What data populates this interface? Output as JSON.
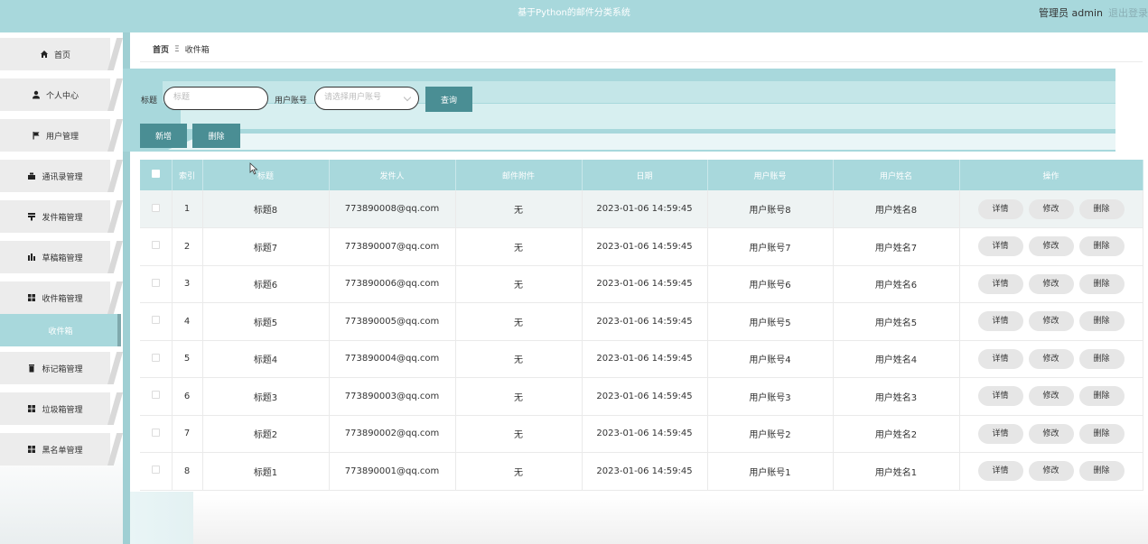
{
  "header": {
    "title": "基于Python的邮件分类系统",
    "user": "管理员 admin",
    "logout": "退出登录"
  },
  "sidebar": {
    "items": [
      {
        "label": "首页",
        "icon": "home-icon"
      },
      {
        "label": "个人中心",
        "icon": "user-icon"
      },
      {
        "label": "用户管理",
        "icon": "flag-icon"
      },
      {
        "label": "通讯录管理",
        "icon": "contacts-icon"
      },
      {
        "label": "发件箱管理",
        "icon": "outbox-icon"
      },
      {
        "label": "草稿箱管理",
        "icon": "drafts-icon"
      },
      {
        "label": "收件箱管理",
        "icon": "grid-icon"
      },
      {
        "label": "标记箱管理",
        "icon": "trash-can-icon"
      },
      {
        "label": "垃圾箱管理",
        "icon": "grid-icon"
      },
      {
        "label": "黑名单管理",
        "icon": "grid-icon"
      }
    ],
    "active_sub": "收件箱"
  },
  "breadcrumb": {
    "home": "首页",
    "separator": "Ξ",
    "current": "收件箱"
  },
  "search": {
    "title_label": "标题",
    "title_placeholder": "标题",
    "account_label": "用户账号",
    "account_placeholder": "请选择用户账号",
    "query_button": "查询"
  },
  "actions": {
    "add": "新增",
    "delete": "删除"
  },
  "table": {
    "headers": [
      "",
      "索引",
      "标题",
      "发件人",
      "邮件附件",
      "日期",
      "用户账号",
      "用户姓名",
      "操作"
    ],
    "rows": [
      {
        "idx": "1",
        "title": "标题8",
        "sender": "773890008@qq.com",
        "attach": "无",
        "date": "2023-01-06 14:59:45",
        "account": "用户账号8",
        "name": "用户姓名8"
      },
      {
        "idx": "2",
        "title": "标题7",
        "sender": "773890007@qq.com",
        "attach": "无",
        "date": "2023-01-06 14:59:45",
        "account": "用户账号7",
        "name": "用户姓名7"
      },
      {
        "idx": "3",
        "title": "标题6",
        "sender": "773890006@qq.com",
        "attach": "无",
        "date": "2023-01-06 14:59:45",
        "account": "用户账号6",
        "name": "用户姓名6"
      },
      {
        "idx": "4",
        "title": "标题5",
        "sender": "773890005@qq.com",
        "attach": "无",
        "date": "2023-01-06 14:59:45",
        "account": "用户账号5",
        "name": "用户姓名5"
      },
      {
        "idx": "5",
        "title": "标题4",
        "sender": "773890004@qq.com",
        "attach": "无",
        "date": "2023-01-06 14:59:45",
        "account": "用户账号4",
        "name": "用户姓名4"
      },
      {
        "idx": "6",
        "title": "标题3",
        "sender": "773890003@qq.com",
        "attach": "无",
        "date": "2023-01-06 14:59:45",
        "account": "用户账号3",
        "name": "用户姓名3"
      },
      {
        "idx": "7",
        "title": "标题2",
        "sender": "773890002@qq.com",
        "attach": "无",
        "date": "2023-01-06 14:59:45",
        "account": "用户账号2",
        "name": "用户姓名2"
      },
      {
        "idx": "8",
        "title": "标题1",
        "sender": "773890001@qq.com",
        "attach": "无",
        "date": "2023-01-06 14:59:45",
        "account": "用户账号1",
        "name": "用户姓名1"
      }
    ],
    "row_actions": {
      "detail": "详情",
      "edit": "修改",
      "delete": "删除"
    }
  },
  "colors": {
    "accent": "#a8d8dc",
    "button_dark": "#4a8e94"
  }
}
